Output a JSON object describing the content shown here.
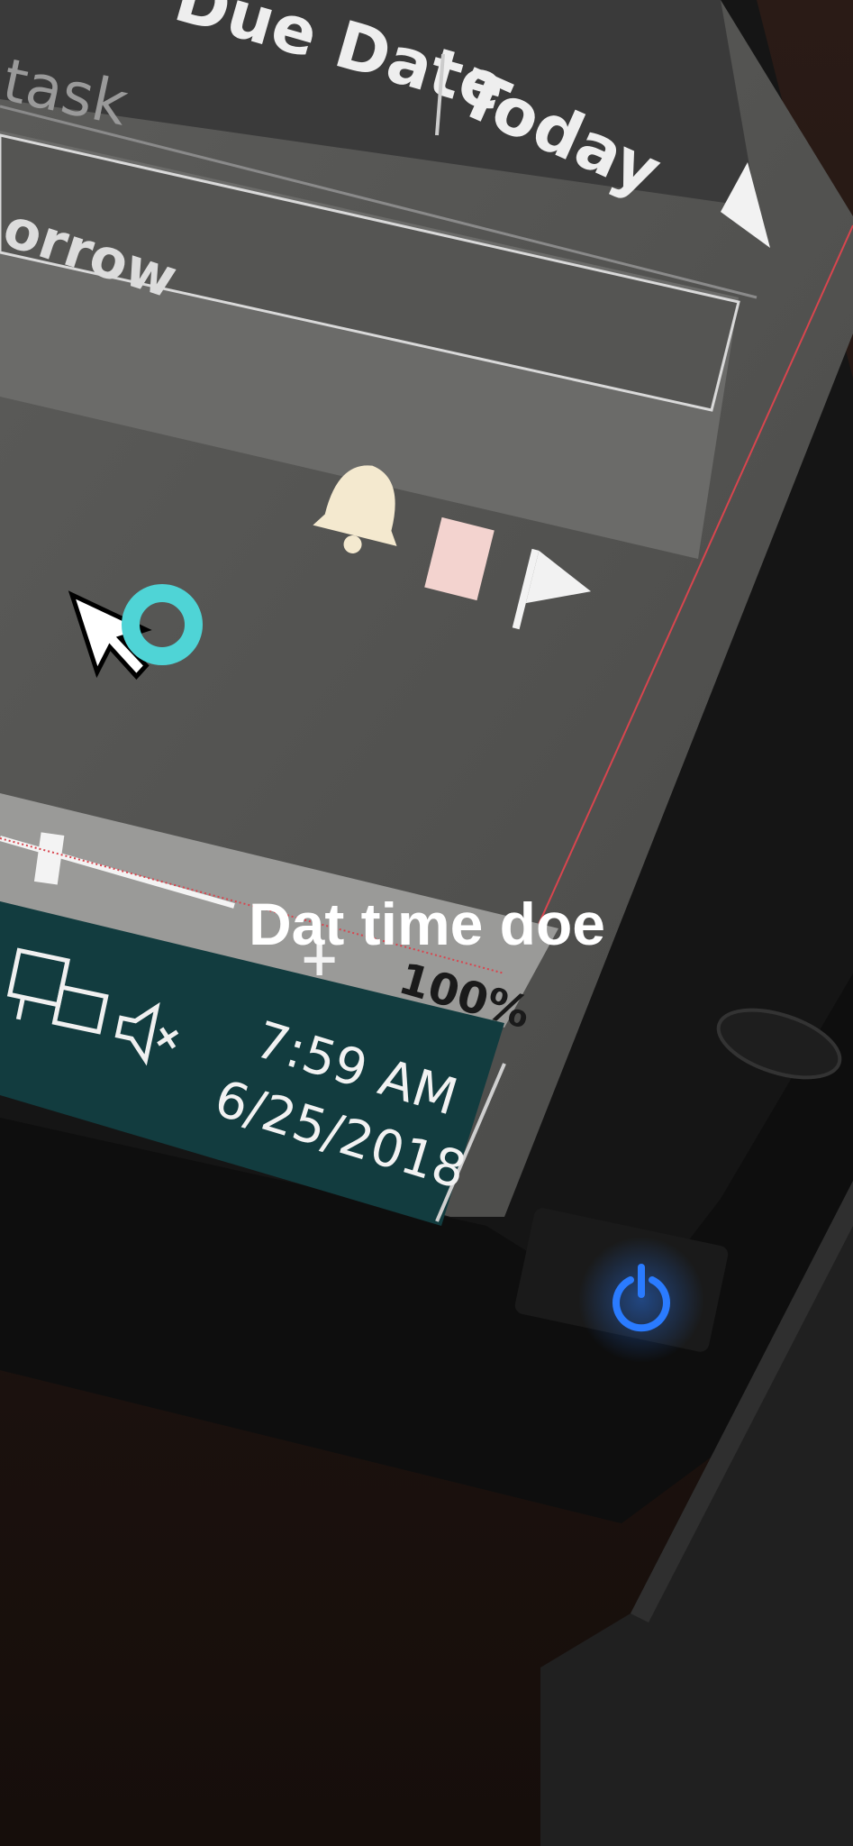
{
  "outlook": {
    "header_due_date": "Due Date",
    "header_today": "Today",
    "task_placeholder": "task",
    "tomorrow_group": "orrow",
    "icons": [
      "bell-icon",
      "category-icon",
      "flag-icon"
    ],
    "zoom_level": "100%"
  },
  "taskbar": {
    "icons": [
      "network-icon",
      "volume-muted-icon"
    ],
    "time": "7:59 AM",
    "date": "6/25/2018"
  },
  "monitor": {
    "power_led_color": "#1f6dff"
  },
  "overlay": {
    "caption": "Dat time doe"
  }
}
